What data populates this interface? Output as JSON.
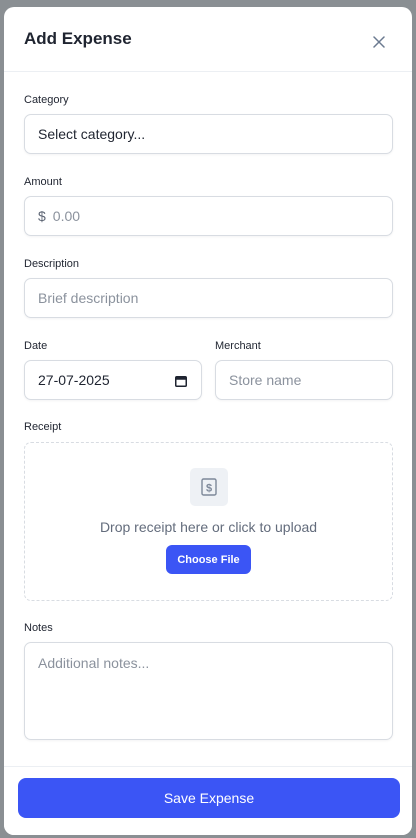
{
  "modal": {
    "title": "Add Expense",
    "close_icon": "close-icon"
  },
  "form": {
    "category": {
      "label": "Category",
      "value": "Select category..."
    },
    "amount": {
      "label": "Amount",
      "prefix": "$",
      "placeholder": "0.00"
    },
    "description": {
      "label": "Description",
      "placeholder": "Brief description"
    },
    "date": {
      "label": "Date",
      "value": "27-07-2025",
      "icon": "calendar-icon"
    },
    "merchant": {
      "label": "Merchant",
      "placeholder": "Store name"
    },
    "receipt": {
      "label": "Receipt",
      "icon": "receipt-icon",
      "drop_text": "Drop receipt here or click to upload",
      "button_label": "Choose File"
    },
    "notes": {
      "label": "Notes",
      "placeholder": "Additional notes..."
    }
  },
  "footer": {
    "save_label": "Save Expense"
  },
  "colors": {
    "accent": "#3b55f5",
    "border": "#d8dce2",
    "text": "#1f2430",
    "muted": "#8b929d"
  }
}
